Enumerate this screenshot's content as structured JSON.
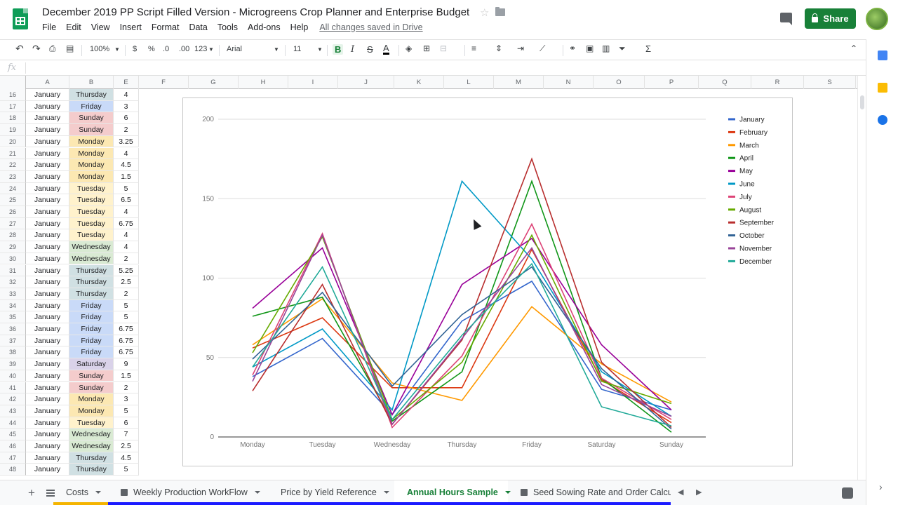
{
  "app": {
    "title": "December 2019 PP Script Filled Version - Microgreens Crop Planner and Enterprise Budget",
    "saved_status": "All changes saved in Drive",
    "share_label": "Share"
  },
  "menu": [
    "File",
    "Edit",
    "View",
    "Insert",
    "Format",
    "Data",
    "Tools",
    "Add-ons",
    "Help"
  ],
  "toolbar": {
    "zoom": "100%",
    "currency": "$",
    "percent": "%",
    "dec_less": ".0",
    "dec_more": ".00",
    "format_more": "123",
    "font": "Arial",
    "font_size": "11",
    "bold": "B",
    "italic": "I",
    "strike": "S",
    "text_color": "A"
  },
  "formula_bar": {
    "fx": "fx"
  },
  "columns": [
    "A",
    "B",
    "E",
    "F",
    "G",
    "H",
    "I",
    "J",
    "K",
    "L",
    "M",
    "N",
    "O",
    "P",
    "Q",
    "R",
    "S"
  ],
  "rows": [
    {
      "n": "16",
      "month": "January",
      "day": "Thursday",
      "hours": "4"
    },
    {
      "n": "17",
      "month": "January",
      "day": "Friday",
      "hours": "3"
    },
    {
      "n": "18",
      "month": "January",
      "day": "Sunday",
      "hours": "6"
    },
    {
      "n": "19",
      "month": "January",
      "day": "Sunday",
      "hours": "2"
    },
    {
      "n": "20",
      "month": "January",
      "day": "Monday",
      "hours": "3.25"
    },
    {
      "n": "21",
      "month": "January",
      "day": "Monday",
      "hours": "4"
    },
    {
      "n": "22",
      "month": "January",
      "day": "Monday",
      "hours": "4.5"
    },
    {
      "n": "23",
      "month": "January",
      "day": "Monday",
      "hours": "1.5"
    },
    {
      "n": "24",
      "month": "January",
      "day": "Tuesday",
      "hours": "5"
    },
    {
      "n": "25",
      "month": "January",
      "day": "Tuesday",
      "hours": "6.5"
    },
    {
      "n": "26",
      "month": "January",
      "day": "Tuesday",
      "hours": "4"
    },
    {
      "n": "27",
      "month": "January",
      "day": "Tuesday",
      "hours": "6.75"
    },
    {
      "n": "28",
      "month": "January",
      "day": "Tuesday",
      "hours": "4"
    },
    {
      "n": "29",
      "month": "January",
      "day": "Wednesday",
      "hours": "4"
    },
    {
      "n": "30",
      "month": "January",
      "day": "Wednesday",
      "hours": "2"
    },
    {
      "n": "31",
      "month": "January",
      "day": "Thursday",
      "hours": "5.25"
    },
    {
      "n": "32",
      "month": "January",
      "day": "Thursday",
      "hours": "2.5"
    },
    {
      "n": "33",
      "month": "January",
      "day": "Thursday",
      "hours": "2"
    },
    {
      "n": "34",
      "month": "January",
      "day": "Friday",
      "hours": "5"
    },
    {
      "n": "35",
      "month": "January",
      "day": "Friday",
      "hours": "5"
    },
    {
      "n": "36",
      "month": "January",
      "day": "Friday",
      "hours": "6.75"
    },
    {
      "n": "37",
      "month": "January",
      "day": "Friday",
      "hours": "6.75"
    },
    {
      "n": "38",
      "month": "January",
      "day": "Friday",
      "hours": "6.75"
    },
    {
      "n": "39",
      "month": "January",
      "day": "Saturday",
      "hours": "9"
    },
    {
      "n": "40",
      "month": "January",
      "day": "Sunday",
      "hours": "1.5"
    },
    {
      "n": "41",
      "month": "January",
      "day": "Sunday",
      "hours": "2"
    },
    {
      "n": "42",
      "month": "January",
      "day": "Monday",
      "hours": "3"
    },
    {
      "n": "43",
      "month": "January",
      "day": "Monday",
      "hours": "5"
    },
    {
      "n": "44",
      "month": "January",
      "day": "Tuesday",
      "hours": "6"
    },
    {
      "n": "45",
      "month": "January",
      "day": "Wednesday",
      "hours": "7"
    },
    {
      "n": "46",
      "month": "January",
      "day": "Wednesday",
      "hours": "2.5"
    },
    {
      "n": "47",
      "month": "January",
      "day": "Thursday",
      "hours": "4.5"
    },
    {
      "n": "48",
      "month": "January",
      "day": "Thursday",
      "hours": "5"
    }
  ],
  "day_colors": {
    "Monday": "#fce8b2",
    "Tuesday": "#fff2cc",
    "Wednesday": "#d9ead3",
    "Thursday": "#d0e0e3",
    "Friday": "#c9daf8",
    "Saturday": "#d9d2e9",
    "Sunday": "#f4cccc"
  },
  "tabs": [
    {
      "label": "Costs",
      "color": "#f4b400",
      "icon": false,
      "active": false
    },
    {
      "label": "Weekly Production WorkFlow",
      "color": "#1a1aff",
      "icon": true,
      "active": false
    },
    {
      "label": "Price by Yield Reference",
      "color": "#1a1aff",
      "icon": false,
      "active": false
    },
    {
      "label": "Annual Hours Sample",
      "color": "#1a1aff",
      "icon": false,
      "active": true
    },
    {
      "label": "Seed Sowing Rate and Order Calcu",
      "color": "#1a1aff",
      "icon": true,
      "active": false
    }
  ],
  "chart_data": {
    "type": "line",
    "categories": [
      "Monday",
      "Tuesday",
      "Wednesday",
      "Thursday",
      "Friday",
      "Saturday",
      "Sunday"
    ],
    "ylim": [
      0,
      200
    ],
    "yticks": [
      0,
      50,
      100,
      150,
      200
    ],
    "grid": true,
    "legend": "right",
    "series": [
      {
        "name": "January",
        "color": "#3366cc",
        "values": [
          38,
          62,
          14,
          73,
          98,
          30,
          17
        ]
      },
      {
        "name": "February",
        "color": "#dc3912",
        "values": [
          56,
          75,
          31,
          31,
          118,
          36,
          9
        ]
      },
      {
        "name": "March",
        "color": "#ff9900",
        "values": [
          58,
          87,
          34,
          23,
          82,
          46,
          22
        ]
      },
      {
        "name": "April",
        "color": "#109618",
        "values": [
          76,
          88,
          10,
          41,
          161,
          37,
          3
        ]
      },
      {
        "name": "May",
        "color": "#990099",
        "values": [
          81,
          119,
          14,
          96,
          125,
          58,
          17
        ]
      },
      {
        "name": "June",
        "color": "#0099c6",
        "values": [
          44,
          68,
          17,
          161,
          112,
          41,
          13
        ]
      },
      {
        "name": "July",
        "color": "#dd4477",
        "values": [
          39,
          128,
          6,
          51,
          134,
          37,
          11
        ]
      },
      {
        "name": "August",
        "color": "#66aa00",
        "values": [
          53,
          126,
          11,
          47,
          127,
          35,
          21
        ]
      },
      {
        "name": "September",
        "color": "#b82e2e",
        "values": [
          29,
          96,
          8,
          61,
          175,
          47,
          6
        ]
      },
      {
        "name": "October",
        "color": "#316395",
        "values": [
          49,
          91,
          32,
          77,
          107,
          43,
          5
        ]
      },
      {
        "name": "November",
        "color": "#994499",
        "values": [
          35,
          127,
          8,
          62,
          119,
          33,
          13
        ]
      },
      {
        "name": "December",
        "color": "#22aa99",
        "values": [
          44,
          107,
          11,
          64,
          109,
          19,
          7
        ]
      }
    ]
  }
}
